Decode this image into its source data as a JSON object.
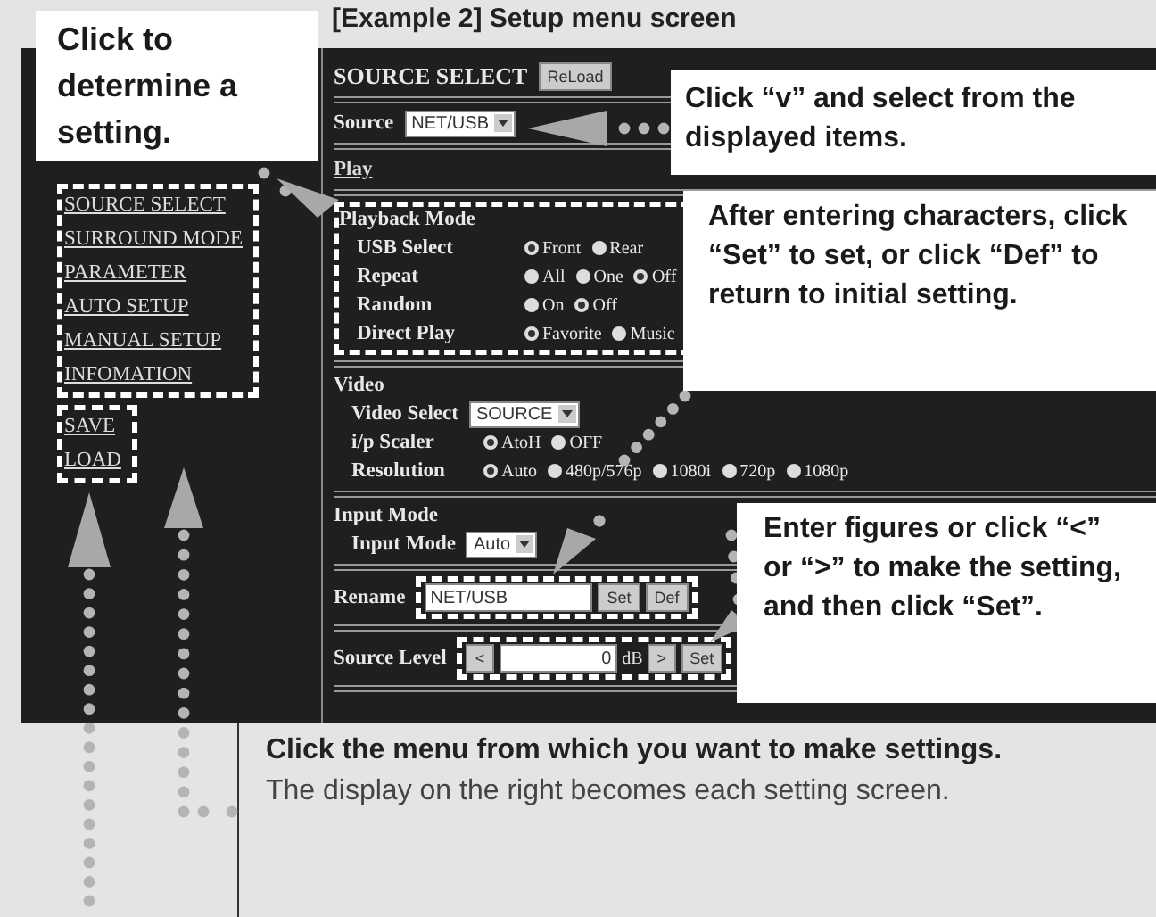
{
  "page_title": "[Example 2] Setup menu screen",
  "nav": [
    "SOURCE SELECT",
    "SURROUND MODE",
    "PARAMETER",
    "AUTO SETUP",
    "MANUAL SETUP",
    "INFOMATION",
    "SAVE",
    "LOAD"
  ],
  "header": {
    "title": "SOURCE SELECT",
    "button": "ReLoad"
  },
  "source": {
    "label": "Source",
    "value": "NET/USB"
  },
  "play_link": "Play",
  "playback": {
    "title": "Playback Mode",
    "rows": [
      {
        "label": "USB Select",
        "options": [
          {
            "label": "Front",
            "selected": true
          },
          {
            "label": "Rear",
            "selected": false
          }
        ]
      },
      {
        "label": "Repeat",
        "options": [
          {
            "label": "All",
            "selected": false
          },
          {
            "label": "One",
            "selected": false
          },
          {
            "label": "Off",
            "selected": true
          }
        ]
      },
      {
        "label": "Random",
        "options": [
          {
            "label": "On",
            "selected": false
          },
          {
            "label": "Off",
            "selected": true
          }
        ]
      },
      {
        "label": "Direct Play",
        "options": [
          {
            "label": "Favorite",
            "selected": true
          },
          {
            "label": "Music",
            "selected": false
          }
        ]
      }
    ]
  },
  "video": {
    "title": "Video",
    "select_label": "Video Select",
    "select_value": "SOURCE",
    "rows": [
      {
        "label": "i/p Scaler",
        "options": [
          {
            "label": "AtoH",
            "selected": true
          },
          {
            "label": "OFF",
            "selected": false
          }
        ]
      },
      {
        "label": "Resolution",
        "options": [
          {
            "label": "Auto",
            "selected": true
          },
          {
            "label": "480p/576p",
            "selected": false
          },
          {
            "label": "1080i",
            "selected": false
          },
          {
            "label": "720p",
            "selected": false
          },
          {
            "label": "1080p",
            "selected": false
          }
        ]
      }
    ]
  },
  "input_mode": {
    "title": "Input Mode",
    "label": "Input Mode",
    "value": "Auto"
  },
  "rename": {
    "label": "Rename",
    "value": "NET/USB",
    "buttons": [
      "Set",
      "Def"
    ]
  },
  "source_level": {
    "label": "Source Level",
    "minus": "<",
    "value": "0",
    "unit": "dB",
    "plus": ">",
    "button": "Set"
  },
  "callouts": [
    "Click to determine a setting.",
    "Click “v” and select from the displayed items.",
    "After entering characters, click “Set” to set, or click “Def” to return to initial setting.",
    "Enter figures or click “<” or “>” to make the setting, and then click “Set”."
  ],
  "caption": {
    "heading": "Click the menu from which you want to make settings.",
    "text": "The display on the right becomes each setting screen."
  }
}
